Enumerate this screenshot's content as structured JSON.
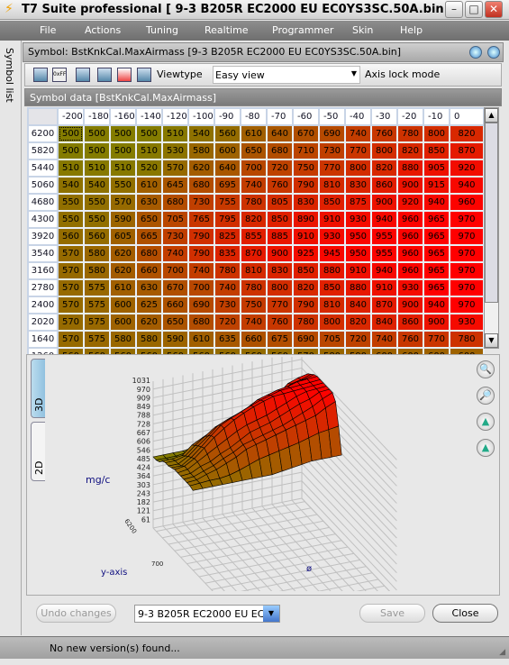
{
  "window": {
    "title": "T7 Suite professional [ 9-3 B205R EC2000 EU EC0YS3SC.50A.bin ]"
  },
  "menu": [
    "File",
    "Actions",
    "Tuning",
    "Realtime",
    "Programmer",
    "Skin",
    "Help"
  ],
  "sidebar": {
    "symbol_list_label": "Symbol list"
  },
  "symbol_header": "Symbol: BstKnkCal.MaxAirmass [9-3 B205R EC2000 EU EC0YS3SC.50A.bin]",
  "toolbar": {
    "viewtype_label": "Viewtype",
    "viewtype_value": "Easy view",
    "axis_lock_label": "Axis lock mode"
  },
  "symbol_data_header": "Symbol data [BstKnkCal.MaxAirmass]",
  "table": {
    "columns": [
      "-200",
      "-180",
      "-160",
      "-140",
      "-120",
      "-100",
      "-90",
      "-80",
      "-70",
      "-60",
      "-50",
      "-40",
      "-30",
      "-20",
      "-10",
      "0"
    ],
    "rows": [
      {
        "label": "6200",
        "values": [
          500,
          500,
          500,
          500,
          510,
          540,
          560,
          610,
          640,
          670,
          690,
          740,
          760,
          780,
          800,
          820
        ]
      },
      {
        "label": "5820",
        "values": [
          500,
          500,
          500,
          510,
          530,
          580,
          600,
          650,
          680,
          710,
          730,
          770,
          800,
          820,
          850,
          870
        ]
      },
      {
        "label": "5440",
        "values": [
          510,
          510,
          510,
          520,
          570,
          620,
          640,
          700,
          720,
          750,
          770,
          800,
          820,
          880,
          905,
          920
        ]
      },
      {
        "label": "5060",
        "values": [
          540,
          540,
          550,
          610,
          645,
          680,
          695,
          740,
          760,
          790,
          810,
          830,
          860,
          900,
          915,
          940
        ]
      },
      {
        "label": "4680",
        "values": [
          550,
          550,
          570,
          630,
          680,
          730,
          755,
          780,
          805,
          830,
          850,
          875,
          900,
          920,
          940,
          960
        ]
      },
      {
        "label": "4300",
        "values": [
          550,
          550,
          590,
          650,
          705,
          765,
          795,
          820,
          850,
          890,
          910,
          930,
          940,
          960,
          965,
          970
        ]
      },
      {
        "label": "3920",
        "values": [
          560,
          560,
          605,
          665,
          730,
          790,
          825,
          855,
          885,
          910,
          930,
          950,
          955,
          960,
          965,
          970
        ]
      },
      {
        "label": "3540",
        "values": [
          570,
          580,
          620,
          680,
          740,
          790,
          835,
          870,
          900,
          925,
          945,
          950,
          955,
          960,
          965,
          970
        ]
      },
      {
        "label": "3160",
        "values": [
          570,
          580,
          620,
          660,
          700,
          740,
          780,
          810,
          830,
          850,
          880,
          910,
          940,
          960,
          965,
          970
        ]
      },
      {
        "label": "2780",
        "values": [
          570,
          575,
          610,
          630,
          670,
          700,
          740,
          780,
          800,
          820,
          850,
          880,
          910,
          930,
          965,
          970
        ]
      },
      {
        "label": "2400",
        "values": [
          570,
          575,
          600,
          625,
          660,
          690,
          730,
          750,
          770,
          790,
          810,
          840,
          870,
          900,
          940,
          970
        ]
      },
      {
        "label": "2020",
        "values": [
          570,
          575,
          600,
          620,
          650,
          680,
          720,
          740,
          760,
          780,
          800,
          820,
          840,
          860,
          900,
          930
        ]
      },
      {
        "label": "1640",
        "values": [
          570,
          575,
          580,
          580,
          590,
          610,
          635,
          660,
          675,
          690,
          705,
          720,
          740,
          760,
          770,
          780
        ]
      },
      {
        "label": "1260",
        "values": [
          560,
          560,
          560,
          560,
          560,
          560,
          560,
          560,
          560,
          570,
          580,
          590,
          600,
          600,
          600,
          600
        ]
      }
    ]
  },
  "colors": {
    "low": "#847c00",
    "high": "#ff0000",
    "grid_line": "#c0c0c0",
    "axis_label": "#101080"
  },
  "graph": {
    "tabs": [
      "3D Graph",
      "2D Graph"
    ],
    "active_tab": "3D Graph",
    "z_label": "mg/c",
    "y_label": "y-axis",
    "x_label": "ø",
    "z_ticks": [
      "61",
      "121",
      "182",
      "243",
      "303",
      "364",
      "424",
      "485",
      "546",
      "606",
      "667",
      "728",
      "788",
      "849",
      "909",
      "970",
      "1031"
    ],
    "x_ticks": [
      "-200",
      "180",
      "160",
      "140",
      "120",
      "100",
      "-90",
      "-80",
      "-70",
      "-60",
      "-50",
      "-40",
      "-30",
      "-20",
      "-10",
      "0"
    ],
    "y_ticks": [
      "6200",
      "700"
    ],
    "tool_icons": [
      "zoom-in-icon",
      "zoom-out-icon",
      "rotate-left-icon",
      "rotate-right-icon"
    ]
  },
  "bottom": {
    "undo_label": "Undo changes",
    "file_select_value": "9-3 B205R EC2000 EU EC...",
    "save_label": "Save",
    "close_label": "Close"
  },
  "status": {
    "message": "No new version(s) found..."
  }
}
